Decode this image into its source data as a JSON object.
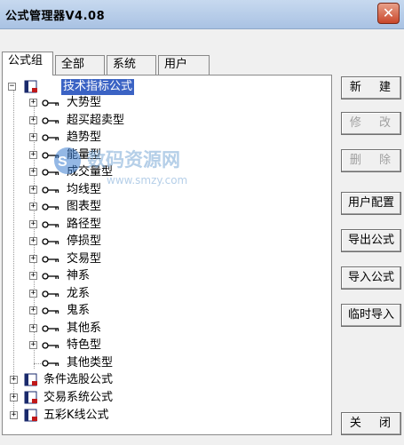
{
  "window": {
    "title": "公式管理器V4.08",
    "close_glyph": "✕"
  },
  "tabs": [
    "公式组",
    "全部",
    "系统",
    "用户"
  ],
  "tree": {
    "root_label": "技术指标公式",
    "categories": [
      "大势型",
      "超买超卖型",
      "趋势型",
      "能量型",
      "成交量型",
      "均线型",
      "图表型",
      "路径型",
      "停损型",
      "交易型",
      "神系",
      "龙系",
      "鬼系",
      "其他系",
      "特色型",
      "其他类型"
    ],
    "top_groups": [
      "条件选股公式",
      "交易系统公式",
      "五彩K线公式"
    ],
    "expander_collapsed": "+",
    "expander_expanded": "−"
  },
  "buttons": {
    "new": "新 建",
    "modify": "修 改",
    "delete": "删 除",
    "user_config": "用户配置",
    "export": "导出公式",
    "import": "导入公式",
    "temp_import": "临时导入",
    "close": "关 闭"
  },
  "watermark": {
    "text": "数码资源网",
    "url": "www.smzy.com"
  },
  "icons": {
    "category": "key-icon",
    "group": "formula-book-icon",
    "close": "close-icon"
  }
}
